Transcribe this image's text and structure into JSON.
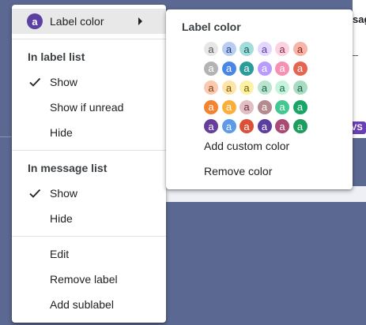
{
  "background": {
    "partial_heading": "sag",
    "badge_fragment": "VS"
  },
  "menu": {
    "label_color": {
      "label": "Label color",
      "avatar_letter": "a",
      "avatar_color": "#5b3fa3"
    },
    "label_list_heading": "In label list",
    "label_list_items": [
      {
        "label": "Show",
        "checked": true
      },
      {
        "label": "Show if unread",
        "checked": false
      },
      {
        "label": "Hide",
        "checked": false
      }
    ],
    "message_list_heading": "In message list",
    "message_list_items": [
      {
        "label": "Show",
        "checked": true
      },
      {
        "label": "Hide",
        "checked": false
      }
    ],
    "actions": [
      "Edit",
      "Remove label",
      "Add sublabel"
    ]
  },
  "color_menu": {
    "title": "Label color",
    "swatch_letter": "a",
    "swatches": [
      [
        {
          "bg": "#e6e6e6",
          "fg": "#555555"
        },
        {
          "bg": "#b8cdf0",
          "fg": "#1a3d7c"
        },
        {
          "bg": "#a2dcdb",
          "fg": "#0c5c5a"
        },
        {
          "bg": "#e3d7ff",
          "fg": "#5a3b9a"
        },
        {
          "bg": "#fbd3e0",
          "fg": "#8a2350"
        },
        {
          "bg": "#f7b4a8",
          "fg": "#8a1f10"
        }
      ],
      [
        {
          "bg": "#b3b3b3",
          "fg": "#ffffff"
        },
        {
          "bg": "#4a86e8",
          "fg": "#ffffff"
        },
        {
          "bg": "#2a9c9a",
          "fg": "#ffffff"
        },
        {
          "bg": "#b99aff",
          "fg": "#ffffff"
        },
        {
          "bg": "#f691b3",
          "fg": "#ffffff"
        },
        {
          "bg": "#e66550",
          "fg": "#ffffff"
        }
      ],
      [
        {
          "bg": "#f9c9b0",
          "fg": "#8a3d12"
        },
        {
          "bg": "#fde4a7",
          "fg": "#7a5200"
        },
        {
          "bg": "#fdf1a5",
          "fg": "#6f6100"
        },
        {
          "bg": "#b9e4d0",
          "fg": "#1d6040"
        },
        {
          "bg": "#c6f3de",
          "fg": "#1b6a45"
        },
        {
          "bg": "#a8dcc2",
          "fg": "#1d5e3e"
        }
      ],
      [
        {
          "bg": "#f4822e",
          "fg": "#ffffff"
        },
        {
          "bg": "#fcae3a",
          "fg": "#ffffff"
        },
        {
          "bg": "#e0bfc4",
          "fg": "#6b2f38"
        },
        {
          "bg": "#b58a8f",
          "fg": "#ffffff"
        },
        {
          "bg": "#42c890",
          "fg": "#ffffff"
        },
        {
          "bg": "#16a766",
          "fg": "#ffffff"
        }
      ],
      [
        {
          "bg": "#653e9b",
          "fg": "#ffffff"
        },
        {
          "bg": "#5d9ae8",
          "fg": "#ffffff"
        },
        {
          "bg": "#dd5036",
          "fg": "#ffffff"
        },
        {
          "bg": "#5b3d9e",
          "fg": "#ffffff"
        },
        {
          "bg": "#a84a73",
          "fg": "#ffffff"
        },
        {
          "bg": "#1c9e5e",
          "fg": "#ffffff"
        }
      ]
    ],
    "add_custom": "Add custom color",
    "remove": "Remove color"
  }
}
